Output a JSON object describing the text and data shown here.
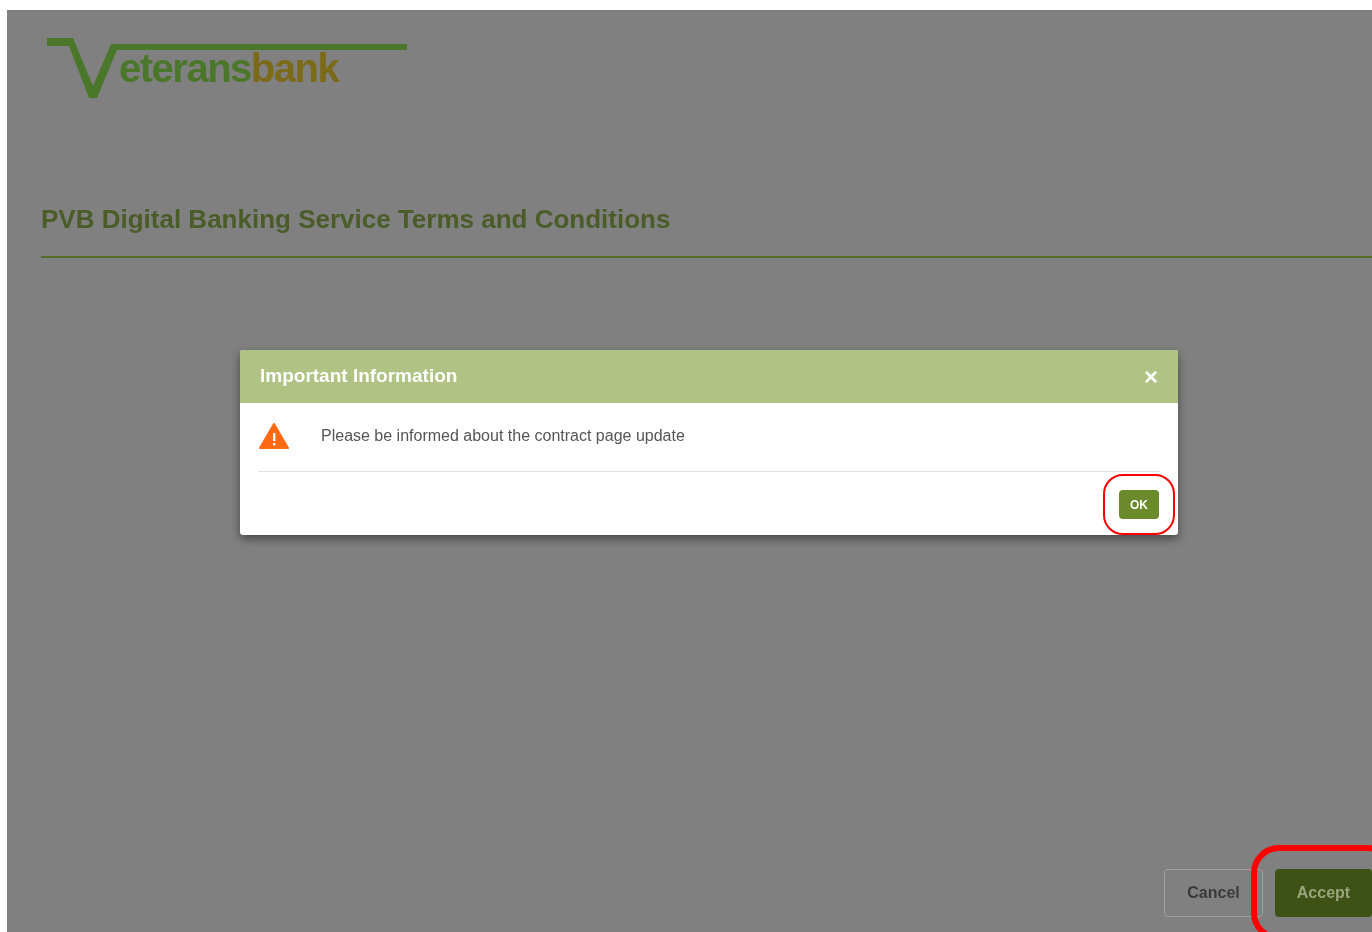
{
  "logo": {
    "text_1": "eterans",
    "text_2": "bank"
  },
  "page_title": "PVB Digital Banking Service Terms and Conditions",
  "dialog": {
    "title": "Important Information",
    "close": "×",
    "message": "Please be informed about the contract page update",
    "buttons": [
      {
        "label": "OK",
        "highlighted": true
      }
    ]
  },
  "footer_buttons": [
    {
      "label": "Cancel",
      "kind": "secondary"
    },
    {
      "label": "Accept",
      "kind": "primary",
      "highlighted": true
    }
  ]
}
